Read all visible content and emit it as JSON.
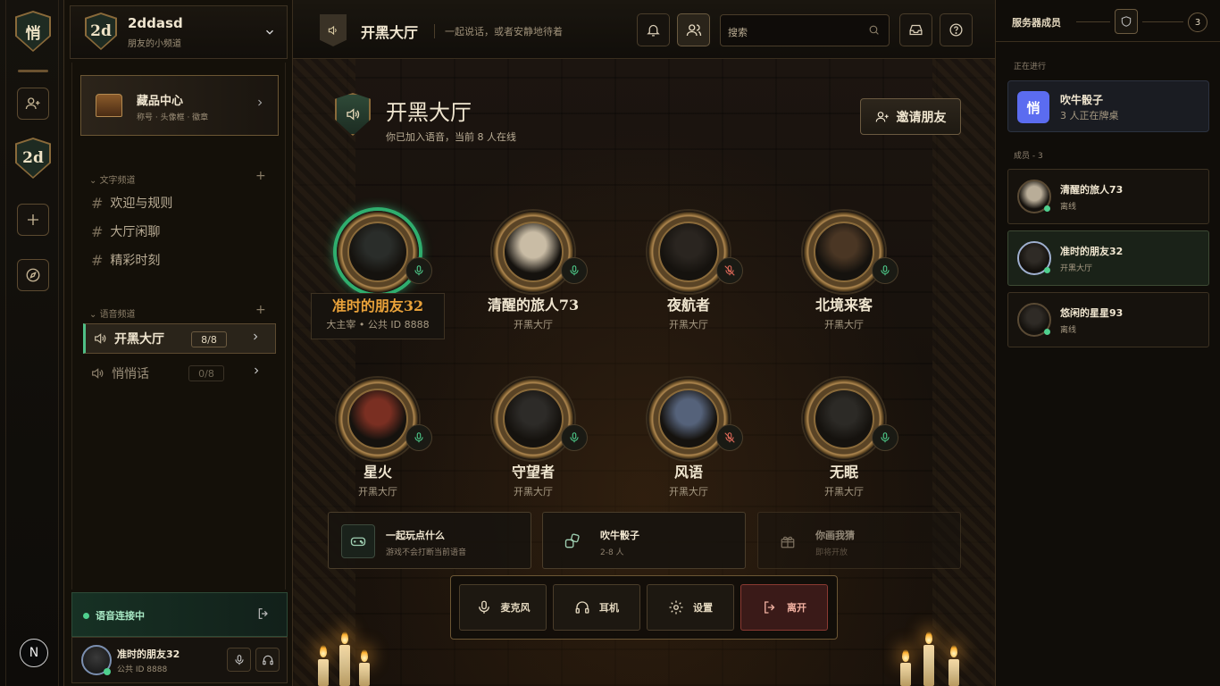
{
  "rail": {
    "app_logo": "悄",
    "server": "2d",
    "new": "N",
    "icons": [
      "add-friend-icon",
      "plus-icon",
      "compass-icon"
    ]
  },
  "server": {
    "badge": "2d",
    "name": "2ddasd",
    "subtitle": "朋友的小频道"
  },
  "collection": {
    "title": "藏品中心",
    "subtitle": "称号 · 头像框 · 徽章"
  },
  "text_channels": {
    "header": "文字频道",
    "items": [
      {
        "label": "欢迎与规则"
      },
      {
        "label": "大厅闲聊"
      },
      {
        "label": "精彩时刻"
      }
    ]
  },
  "voice_channels": {
    "header": "语音频道",
    "items": [
      {
        "label": "开黑大厅",
        "count": "8/8",
        "active": true
      },
      {
        "label": "悄悄话",
        "count": "0/8",
        "active": false
      }
    ]
  },
  "voice_status": {
    "label": "语音连接中"
  },
  "me": {
    "name": "准时的朋友32",
    "id": "公共 ID 8888"
  },
  "topbar": {
    "title": "开黑大厅",
    "subtitle": "一起说话，或者安静地待着",
    "search_placeholder": "搜索"
  },
  "hall": {
    "title": "开黑大厅",
    "subtitle": "你已加入语音，当前 8 人在线",
    "invite_label": "邀请朋友"
  },
  "seats": [
    {
      "name": "准时的朋友32",
      "loc": "大主宰 • 公共 ID 8888",
      "mic": "on",
      "speaking": true,
      "me": true
    },
    {
      "name": "清醒的旅人73",
      "loc": "开黑大厅",
      "mic": "on"
    },
    {
      "name": "夜航者",
      "loc": "开黑大厅",
      "mic": "muted"
    },
    {
      "name": "北境来客",
      "loc": "开黑大厅",
      "mic": "on"
    },
    {
      "name": "星火",
      "loc": "开黑大厅",
      "mic": "on"
    },
    {
      "name": "守望者",
      "loc": "开黑大厅",
      "mic": "on"
    },
    {
      "name": "风语",
      "loc": "开黑大厅",
      "mic": "muted"
    },
    {
      "name": "无眠",
      "loc": "开黑大厅",
      "mic": "on"
    }
  ],
  "games": [
    {
      "title": "一起玩点什么",
      "sub": "游戏不会打断当前语音"
    },
    {
      "title": "吹牛骰子",
      "sub": "2-8 人"
    },
    {
      "title": "你画我猜",
      "sub": "即将开放"
    }
  ],
  "controls": {
    "mic": "麦克风",
    "headset": "耳机",
    "settings": "设置",
    "leave": "离开"
  },
  "members_panel": {
    "title": "服务器成员",
    "count": "3",
    "live_header": "正在进行",
    "live": {
      "logo": "悄",
      "title": "吹牛骰子",
      "sub": "3 人正在牌桌"
    },
    "members_header": "成员 - 3",
    "members": [
      {
        "name": "清醒的旅人73",
        "status": "离线"
      },
      {
        "name": "准时的朋友32",
        "status": "开黑大厅"
      },
      {
        "name": "悠闲的星星93",
        "status": "离线"
      }
    ]
  },
  "colors": {
    "accent_green": "#4fd08e",
    "gold": "#b08850",
    "name_me": "#e9a23a",
    "muted_red": "#e06a5a",
    "live_logo": "#5b6cf0"
  }
}
